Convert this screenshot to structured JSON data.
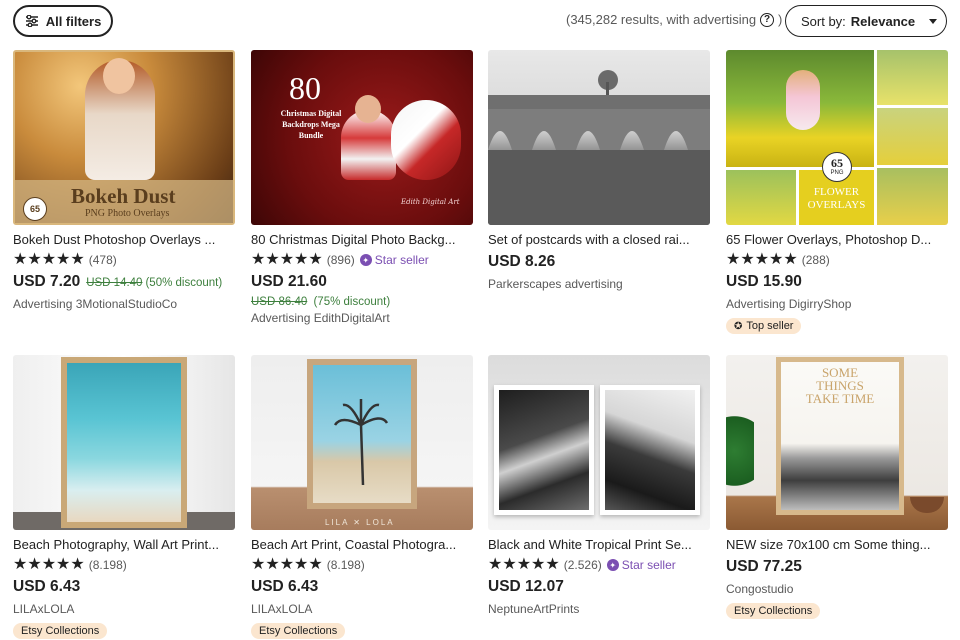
{
  "toolbar": {
    "filters_label": "All filters",
    "results_text": "(345,282 results, with advertising",
    "results_close": ")",
    "help_glyph": "?",
    "sort_prefix": "Sort by:",
    "sort_value": "Relevance"
  },
  "listings": [
    {
      "title": "Bokeh Dust Photoshop Overlays ...",
      "stars": "★★★★★",
      "count": "(478)",
      "price": "USD 7.20",
      "original_price": "USD 14.40",
      "discount": "(50% discount)",
      "shop": "Advertising 3MotionalStudioCo",
      "overlay_text_1": "Bokeh Dust",
      "overlay_text_2": "PNG Photo Overlays",
      "overlay_count": "65"
    },
    {
      "title": "80 Christmas Digital Photo Backg...",
      "stars": "★★★★★",
      "count": "(896)",
      "star_seller": "Star seller",
      "price": "USD 21.60",
      "original_price": "USD 86.40",
      "discount": "(75% discount)",
      "shop": "Advertising EdithDigitalArt",
      "overlay_num": "80",
      "overlay_text": "Christmas Digital Backdrops Mega Bundle",
      "overlay_sig": "Edith Digital Art"
    },
    {
      "title": "Set of postcards with a closed rai...",
      "price": "USD 8.26",
      "shop": "Parkerscapes advertising"
    },
    {
      "title": "65 Flower Overlays, Photoshop D...",
      "stars": "★★★★★",
      "count": "(288)",
      "price": "USD 15.90",
      "shop": "Advertising DigirryShop",
      "badge": "Top seller",
      "overlay_num": "65",
      "overlay_sub": "PNG",
      "overlay_text_1": "FLOWER",
      "overlay_text_2": "OVERLAYS"
    },
    {
      "title": "Beach Photography, Wall Art Print...",
      "stars": "★★★★★",
      "count": "(8.198)",
      "price": "USD 6.43",
      "shop": "LILAxLOLA",
      "badge": "Etsy Collections"
    },
    {
      "title": "Beach Art Print, Coastal Photogra...",
      "stars": "★★★★★",
      "count": "(8.198)",
      "price": "USD 6.43",
      "shop": "LILAxLOLA",
      "badge": "Etsy Collections",
      "watermark": "LILA ✕ LOLA"
    },
    {
      "title": "Black and White Tropical Print Se...",
      "stars": "★★★★★",
      "count": "(2.526)",
      "star_seller": "Star seller",
      "price": "USD 12.07",
      "shop": "NeptuneArtPrints"
    },
    {
      "title": "NEW size 70x100 cm Some thing...",
      "price": "USD 77.25",
      "shop": "Congostudio",
      "badge": "Etsy Collections",
      "poster_text": "SOME THINGS TAKE TIME"
    }
  ],
  "colors": {
    "accent_purple": "#7b4fb2",
    "discount_green": "#3d7f3d",
    "badge_bg": "#fbe6cf"
  }
}
